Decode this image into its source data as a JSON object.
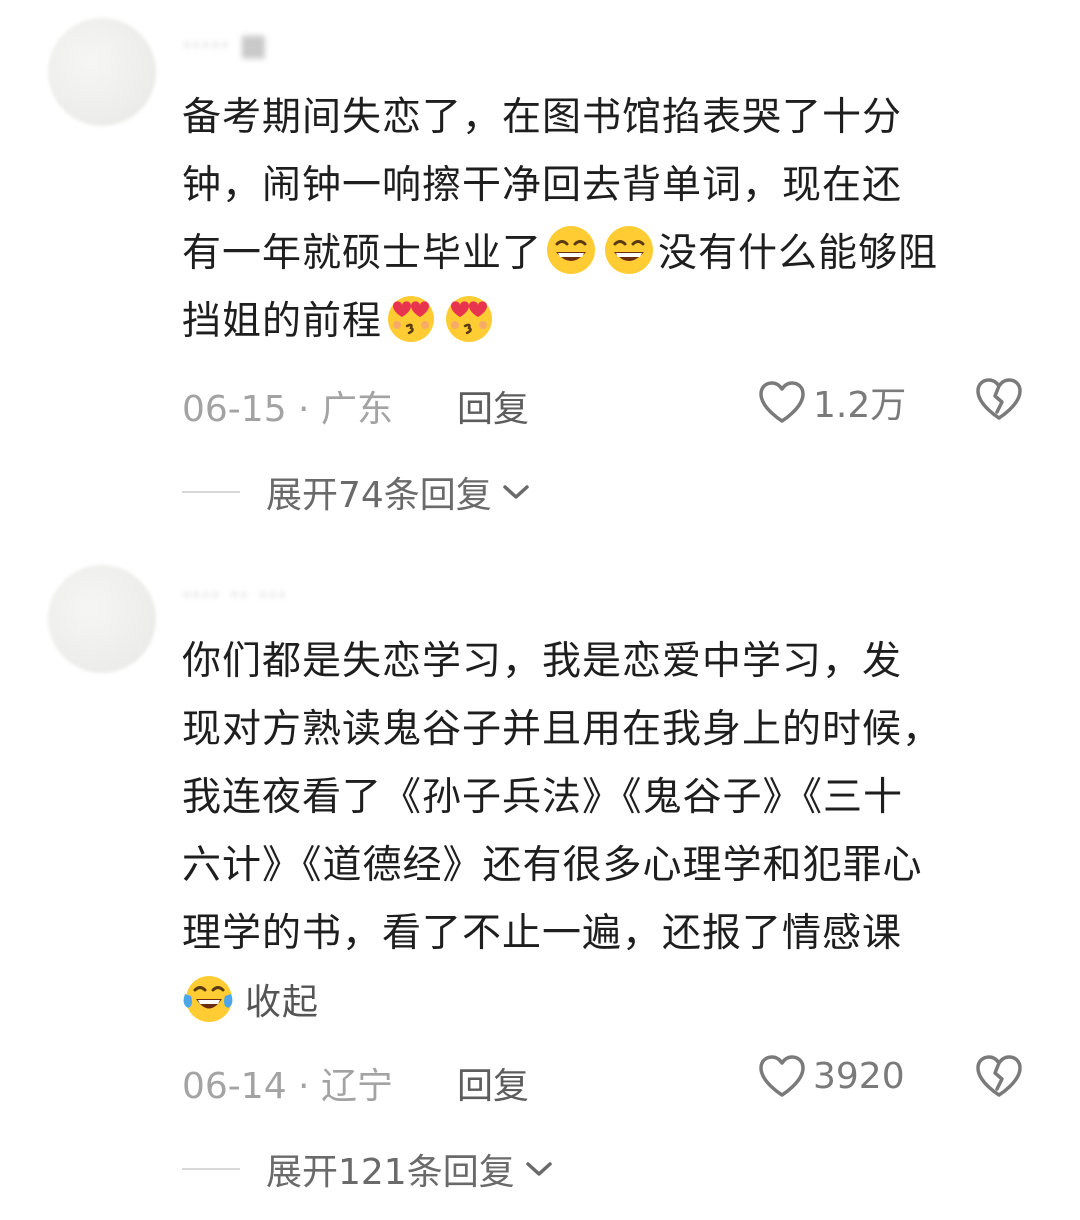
{
  "comments": [
    {
      "username": "····· ■",
      "text_lines": [
        "备考期间失恋了，在图书馆掐表哭了十分",
        "钟，闹钟一响擦干净回去背单词，现在还",
        "有一年就硕士毕业了",
        "没有什么能够阻",
        "挡姐的前程"
      ],
      "date": "06-15 · 广东",
      "reply_label": "回复",
      "likes": "1.2万",
      "expand_label": "展开74条回复"
    },
    {
      "username": "···· ·· ···",
      "text_lines": [
        "你们都是失恋学习，我是恋爱中学习，发",
        "现对方熟读鬼谷子并且用在我身上的时候，",
        "我连夜看了《孙子兵法》《鬼谷子》《三十",
        "六计》《道德经》还有很多心理学和犯罪心",
        "理学的书，看了不止一遍，还报了情感课"
      ],
      "collapse_label": "收起",
      "date": "06-14 · 辽宁",
      "reply_label": "回复",
      "likes": "3920",
      "expand_label": "展开121条回复"
    }
  ],
  "icons": {
    "emoji_grin": "grinning-squinting-face-icon",
    "emoji_hearts": "smiling-face-with-heart-eyes-icon",
    "emoji_laugh_cry": "laughing-crying-face-icon",
    "like": "heart-outline-icon",
    "dislike": "broken-heart-icon",
    "expand": "chevron-down-icon"
  },
  "colors": {
    "body_text": "#1e1e1e",
    "meta_text": "#a3a3a3",
    "reply_text": "#5d5d5d",
    "expand_text": "#6a6a6a"
  }
}
